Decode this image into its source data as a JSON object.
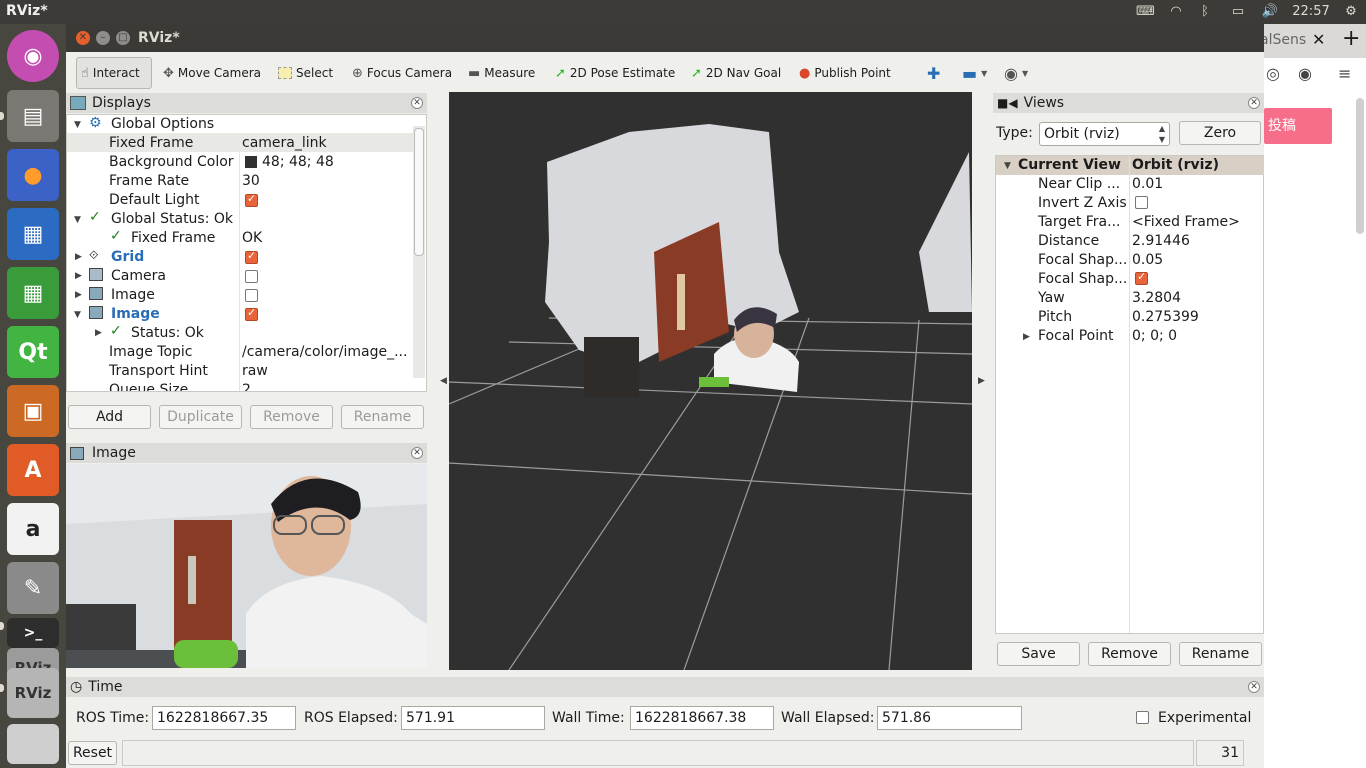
{
  "topbar": {
    "app_title": "RViz*",
    "clock": "22:57"
  },
  "launcher": {
    "items": [
      "ubuntu-dash-icon",
      "files-icon",
      "firefox-icon",
      "writer-icon",
      "calc-icon",
      "qt-icon",
      "impress-icon",
      "software-center-icon",
      "amazon-icon",
      "settings-icon",
      "terminal-icon",
      "rviz-icon",
      "rviz-icon",
      "trash-icon"
    ],
    "qt_label": "Qt",
    "rviz_label": "RViz"
  },
  "bg_window": {
    "tab_fragment": "alSens",
    "button": "投稿"
  },
  "window": {
    "title": "RViz*"
  },
  "toolbar": {
    "interact": "Interact",
    "move_camera": "Move Camera",
    "select": "Select",
    "focus_camera": "Focus Camera",
    "measure": "Measure",
    "pose_estimate": "2D Pose Estimate",
    "nav_goal": "2D Nav Goal",
    "publish_point": "Publish Point"
  },
  "displays": {
    "title": "Displays",
    "global_options": "Global Options",
    "fixed_frame_label": "Fixed Frame",
    "fixed_frame_value": "camera_link",
    "bg_color_label": "Background Color",
    "bg_color_value": "48; 48; 48",
    "frame_rate_label": "Frame Rate",
    "frame_rate_value": "30",
    "default_light_label": "Default Light",
    "global_status": "Global Status: Ok",
    "fixed_frame_status_label": "Fixed Frame",
    "fixed_frame_status_value": "OK",
    "grid": "Grid",
    "camera": "Camera",
    "image1": "Image",
    "image2": "Image",
    "status_ok": "Status: Ok",
    "image_topic_label": "Image Topic",
    "image_topic_value": "/camera/color/image_...",
    "transport_hint_label": "Transport Hint",
    "transport_hint_value": "raw",
    "queue_size_label": "Queue Size",
    "queue_size_value": "2",
    "buttons": {
      "add": "Add",
      "duplicate": "Duplicate",
      "remove": "Remove",
      "rename": "Rename"
    }
  },
  "image_panel": {
    "title": "Image"
  },
  "views": {
    "title": "Views",
    "type_label": "Type:",
    "type_value": "Orbit (rviz)",
    "zero": "Zero",
    "current_view": "Current View",
    "current_view_value": "Orbit (rviz)",
    "props": [
      {
        "label": "Near Clip ...",
        "value": "0.01"
      },
      {
        "label": "Invert Z Axis",
        "value": ""
      },
      {
        "label": "Target Fra...",
        "value": "<Fixed Frame>"
      },
      {
        "label": "Distance",
        "value": "2.91446"
      },
      {
        "label": "Focal Shap...",
        "value": "0.05"
      },
      {
        "label": "Focal Shap...",
        "value": ""
      },
      {
        "label": "Yaw",
        "value": "3.2804"
      },
      {
        "label": "Pitch",
        "value": "0.275399"
      },
      {
        "label": "Focal Point",
        "value": "0; 0; 0"
      }
    ],
    "buttons": {
      "save": "Save",
      "remove": "Remove",
      "rename": "Rename"
    }
  },
  "time": {
    "title": "Time",
    "ros_time_label": "ROS Time:",
    "ros_time": "1622818667.35",
    "ros_elapsed_label": "ROS Elapsed:",
    "ros_elapsed": "571.91",
    "wall_time_label": "Wall Time:",
    "wall_time": "1622818667.38",
    "wall_elapsed_label": "Wall Elapsed:",
    "wall_elapsed": "571.86",
    "experimental": "Experimental",
    "reset": "Reset",
    "fps": "31 fps"
  },
  "colors": {
    "bg_swatch": "#303030",
    "checkbox_on": "#e9643a",
    "viewport_bg": "#303030"
  }
}
